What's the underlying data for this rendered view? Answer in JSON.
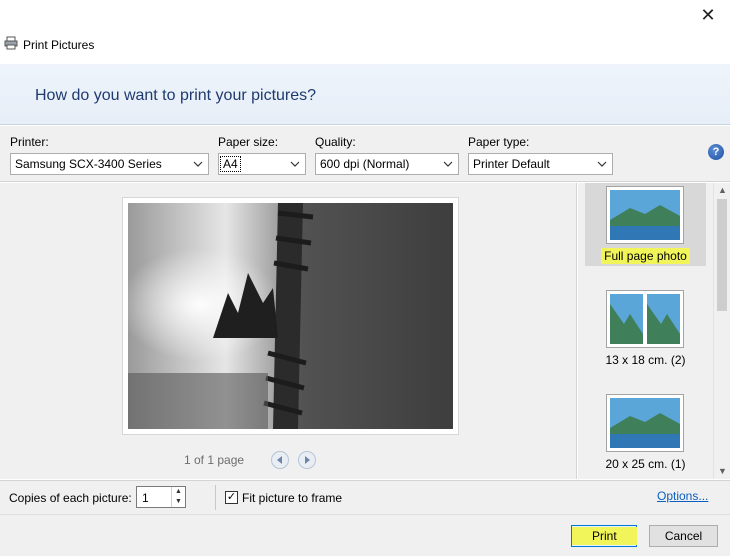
{
  "window": {
    "title": "Print Pictures",
    "close_glyph": "✕"
  },
  "banner": {
    "heading": "How do you want to print your pictures?"
  },
  "options": {
    "printer": {
      "label": "Printer:",
      "value": "Samsung SCX-3400 Series"
    },
    "paper_size": {
      "label": "Paper size:",
      "value": "A4"
    },
    "quality": {
      "label": "Quality:",
      "value": "600 dpi (Normal)"
    },
    "paper_type": {
      "label": "Paper type:",
      "value": "Printer Default"
    },
    "help_glyph": "?"
  },
  "preview": {
    "page_count": "1 of 1 page"
  },
  "layouts": [
    {
      "label": "Full page photo",
      "selected": true
    },
    {
      "label": "13 x 18 cm. (2)",
      "selected": false
    },
    {
      "label": "20 x 25 cm. (1)",
      "selected": false
    }
  ],
  "bottom": {
    "copies_label": "Copies of each picture:",
    "copies_value": "1",
    "fit_label": "Fit picture to frame",
    "fit_checked": true,
    "options_link": "Options..."
  },
  "footer": {
    "print_label": "Print",
    "cancel_label": "Cancel"
  },
  "colors": {
    "highlight": "#f2f55a",
    "link": "#0b5fbf",
    "banner_text": "#1e3a6e"
  }
}
